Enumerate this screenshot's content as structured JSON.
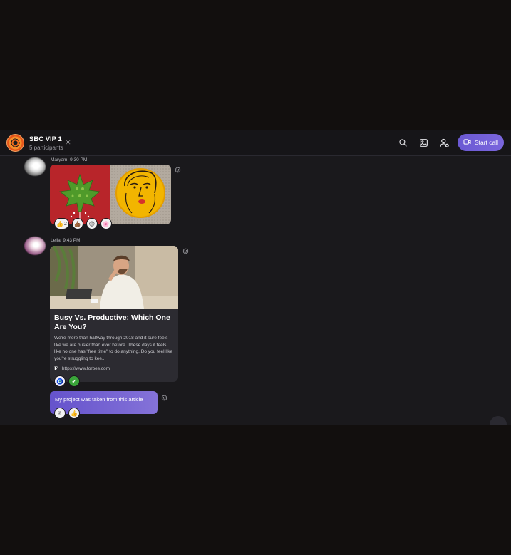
{
  "header": {
    "title": "SBC VIP 1",
    "subtitle": "5 participants",
    "start_call_label": "Start call",
    "icons": [
      "group-avatar",
      "gear-icon",
      "search-icon",
      "gallery-icon",
      "add-person-icon",
      "video-call-icon"
    ]
  },
  "messages": [
    {
      "sender_meta": "Maryam, 9:30 PM",
      "type": "images",
      "reactions": [
        {
          "emoji": "👍",
          "count": "2"
        },
        {
          "emoji": "👍🏾",
          "count": ""
        },
        {
          "emoji": "😊",
          "count": ""
        },
        {
          "emoji": "🌸",
          "count": ""
        }
      ]
    },
    {
      "sender_meta": "Leila, 9:43 PM",
      "type": "link-card",
      "card": {
        "title": "Busy Vs. Productive: Which One Are You?",
        "description": "We're more than halfway through 2018 and it sure feels like we are busier than ever before. These days it feels like no one has \"free time\" to do anything. Do you feel like you're struggling to kee...",
        "link_icon": "F",
        "url": "https://www.forbes.com"
      },
      "reactions": [
        {
          "emoji": "🧿",
          "count": ""
        },
        {
          "emoji": "✔",
          "count": ""
        }
      ]
    },
    {
      "type": "text",
      "text": "My project was taken from this article",
      "reactions": [
        {
          "emoji": "✌",
          "count": ""
        },
        {
          "emoji": "👍",
          "count": ""
        }
      ]
    }
  ],
  "colors": {
    "accent": "#6b59d3",
    "background": "#1a191c",
    "header": "#161518",
    "outer": "#120f0e"
  }
}
